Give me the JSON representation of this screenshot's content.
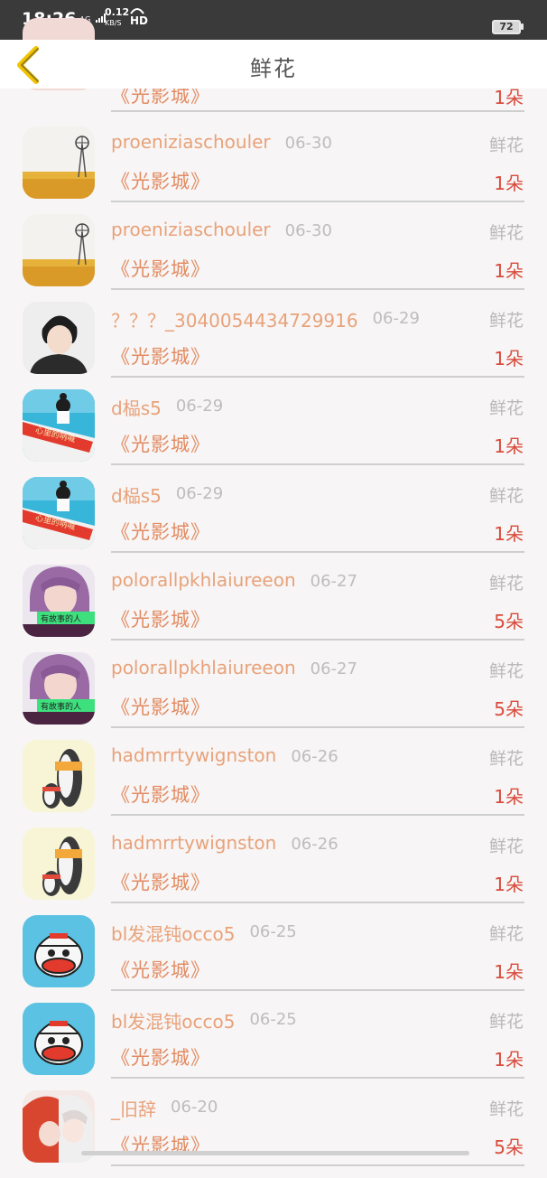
{
  "status_bar": {
    "time": "18:26",
    "network": "4G",
    "speed_value": "0.12",
    "speed_unit": "KB/S",
    "hd": "HD",
    "battery": "72"
  },
  "header": {
    "title": "鲜花"
  },
  "rows": [
    {
      "name": "",
      "date": "",
      "kind": "",
      "movie": "《光影城》",
      "count": "1朵",
      "avatar": "pink"
    },
    {
      "name": "proeniziaschouler",
      "date": "06-30",
      "kind": "鲜花",
      "movie": "《光影城》",
      "count": "1朵",
      "avatar": "wheat-field"
    },
    {
      "name": "proeniziaschouler",
      "date": "06-30",
      "kind": "鲜花",
      "movie": "《光影城》",
      "count": "1朵",
      "avatar": "wheat-field"
    },
    {
      "name": "？？？_3040054434729916",
      "date": "06-29",
      "kind": "鲜花",
      "movie": "《光影城》",
      "count": "1朵",
      "avatar": "boy-portrait"
    },
    {
      "name": "d榀s5",
      "date": "06-29",
      "kind": "鲜花",
      "movie": "《光影城》",
      "count": "1朵",
      "avatar": "girl-blue"
    },
    {
      "name": "d榀s5",
      "date": "06-29",
      "kind": "鲜花",
      "movie": "《光影城》",
      "count": "1朵",
      "avatar": "girl-blue"
    },
    {
      "name": "polorallpkhlaiureeon",
      "date": "06-27",
      "kind": "鲜花",
      "movie": "《光影城》",
      "count": "5朵",
      "avatar": "anime-purple"
    },
    {
      "name": "polorallpkhlaiureeon",
      "date": "06-27",
      "kind": "鲜花",
      "movie": "《光影城》",
      "count": "5朵",
      "avatar": "anime-purple"
    },
    {
      "name": "hadmrrtywignston",
      "date": "06-26",
      "kind": "鲜花",
      "movie": "《光影城》",
      "count": "1朵",
      "avatar": "penguins"
    },
    {
      "name": "hadmrrtywignston",
      "date": "06-26",
      "kind": "鲜花",
      "movie": "《光影城》",
      "count": "1朵",
      "avatar": "penguins"
    },
    {
      "name": "bl发混钝occo5",
      "date": "06-25",
      "kind": "鲜花",
      "movie": "《光影城》",
      "count": "1朵",
      "avatar": "monkey"
    },
    {
      "name": "bl发混钝occo5",
      "date": "06-25",
      "kind": "鲜花",
      "movie": "《光影城》",
      "count": "1朵",
      "avatar": "monkey"
    },
    {
      "name": "_旧辞",
      "date": "06-20",
      "kind": "鲜花",
      "movie": "《光影城》",
      "count": "5朵",
      "avatar": "anime-couple"
    }
  ],
  "avatar_captions": {
    "girl-blue": "心里的呐喊",
    "anime-purple": "有故事的人"
  },
  "colors": {
    "name": "#e8a27a",
    "movie": "#e28b62",
    "count": "#d94b3c",
    "back_arrow": "#f2c300"
  }
}
